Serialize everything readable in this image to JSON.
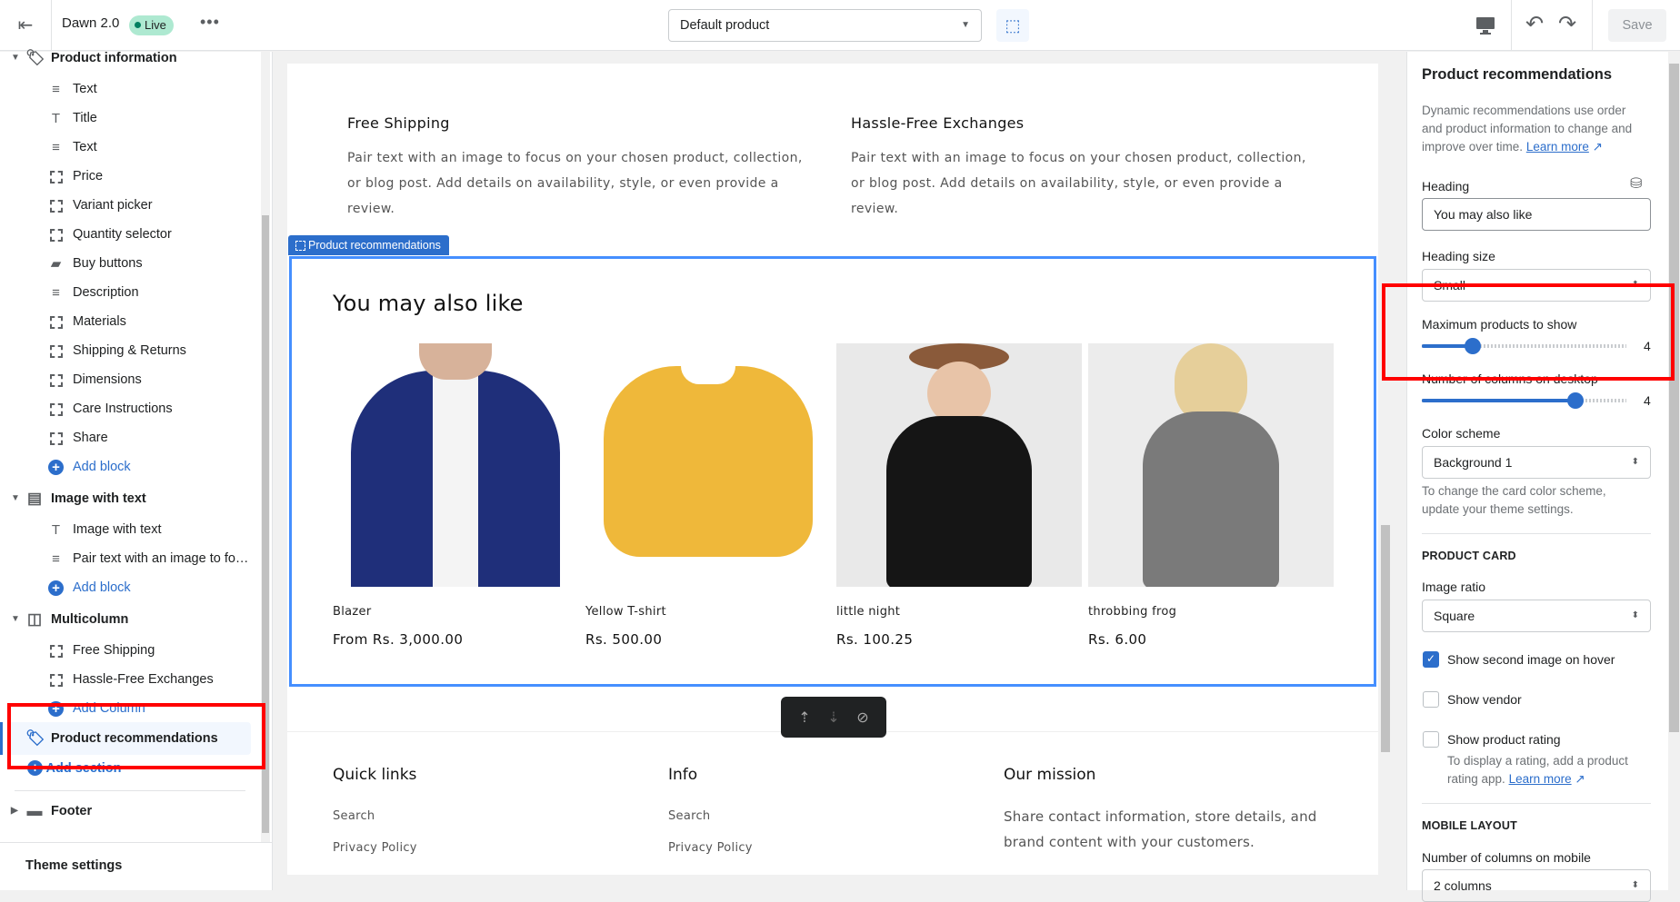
{
  "topbar": {
    "theme_name": "Dawn 2.0",
    "status": "Live",
    "more": "•••",
    "template_select": "Default product",
    "save_label": "Save"
  },
  "sidebar": {
    "sections": [
      {
        "label": "Product information",
        "icon": "tag-icon",
        "blocks": [
          {
            "label": "Text",
            "icon": "text-lines-icon"
          },
          {
            "label": "Title",
            "icon": "title-t-icon"
          },
          {
            "label": "Text",
            "icon": "text-lines-icon"
          },
          {
            "label": "Price",
            "icon": "block-icon"
          },
          {
            "label": "Variant picker",
            "icon": "block-icon"
          },
          {
            "label": "Quantity selector",
            "icon": "block-icon"
          },
          {
            "label": "Buy buttons",
            "icon": "buy-button-icon"
          },
          {
            "label": "Description",
            "icon": "text-lines-icon"
          },
          {
            "label": "Materials",
            "icon": "block-icon"
          },
          {
            "label": "Shipping & Returns",
            "icon": "block-icon"
          },
          {
            "label": "Dimensions",
            "icon": "block-icon"
          },
          {
            "label": "Care Instructions",
            "icon": "block-icon"
          },
          {
            "label": "Share",
            "icon": "block-icon"
          }
        ],
        "add_label": "Add block"
      },
      {
        "label": "Image with text",
        "icon": "image-text-icon",
        "blocks": [
          {
            "label": "Image with text",
            "icon": "title-t-icon"
          },
          {
            "label": "Pair text with an image to foc…",
            "icon": "text-lines-icon"
          }
        ],
        "add_label": "Add block"
      },
      {
        "label": "Multicolumn",
        "icon": "columns-icon",
        "blocks": [
          {
            "label": "Free Shipping",
            "icon": "block-icon"
          },
          {
            "label": "Hassle-Free Exchanges",
            "icon": "block-icon"
          }
        ],
        "add_label": "Add Column"
      }
    ],
    "selected": "Product recommendations",
    "add_section": "Add section",
    "footer": "Footer",
    "theme_settings": "Theme settings"
  },
  "preview": {
    "multicolumn": [
      {
        "heading": "Free Shipping",
        "text": "Pair text with an image to focus on your chosen product, collection, or blog post. Add details on availability, style, or even provide a review."
      },
      {
        "heading": "Hassle-Free Exchanges",
        "text": "Pair text with an image to focus on your chosen product, collection, or blog post. Add details on availability, style, or even provide a review."
      }
    ],
    "section_tag": "Product recommendations",
    "heading": "You may also like",
    "products": [
      {
        "name": "Blazer",
        "price": "From Rs. 3,000.00"
      },
      {
        "name": "Yellow T-shirt",
        "price": "Rs. 500.00"
      },
      {
        "name": "little night",
        "price": "Rs. 100.25"
      },
      {
        "name": "throbbing frog",
        "price": "Rs. 6.00"
      }
    ],
    "footer": {
      "quick_links": {
        "heading": "Quick links",
        "links": [
          "Search",
          "Privacy Policy"
        ]
      },
      "info": {
        "heading": "Info",
        "links": [
          "Search",
          "Privacy Policy"
        ]
      },
      "mission": {
        "heading": "Our mission",
        "text": "Share contact information, store details, and brand content with your customers."
      }
    }
  },
  "settings": {
    "title": "Product recommendations",
    "description": "Dynamic recommendations use order and product information to change and improve over time.",
    "learn_more": "Learn more",
    "heading_label": "Heading",
    "heading_value": "You may also like",
    "heading_size_label": "Heading size",
    "heading_size_value": "Small",
    "max_products_label": "Maximum products to show",
    "max_products": {
      "value": 4,
      "min": 2,
      "max": 10,
      "display": "4"
    },
    "columns_desktop_label": "Number of columns on desktop",
    "columns_desktop": {
      "value": 4,
      "min": 1,
      "max": 5,
      "display": "4"
    },
    "color_scheme_label": "Color scheme",
    "color_scheme_value": "Background 1",
    "color_scheme_help": "To change the card color scheme, update your theme settings.",
    "product_card_header": "PRODUCT CARD",
    "image_ratio_label": "Image ratio",
    "image_ratio_value": "Square",
    "show_second_image": {
      "label": "Show second image on hover",
      "checked": true
    },
    "show_vendor": {
      "label": "Show vendor",
      "checked": false
    },
    "show_rating": {
      "label": "Show product rating",
      "checked": false
    },
    "rating_help": "To display a rating, add a product rating app.",
    "rating_learn_more": "Learn more",
    "mobile_layout_header": "MOBILE LAYOUT",
    "columns_mobile_label": "Number of columns on mobile",
    "columns_mobile_value": "2 columns"
  },
  "colors": {
    "accent": "#2c6ecb",
    "selection": "#458fff",
    "highlight": "#ff0000",
    "live": "#aee9d1"
  }
}
